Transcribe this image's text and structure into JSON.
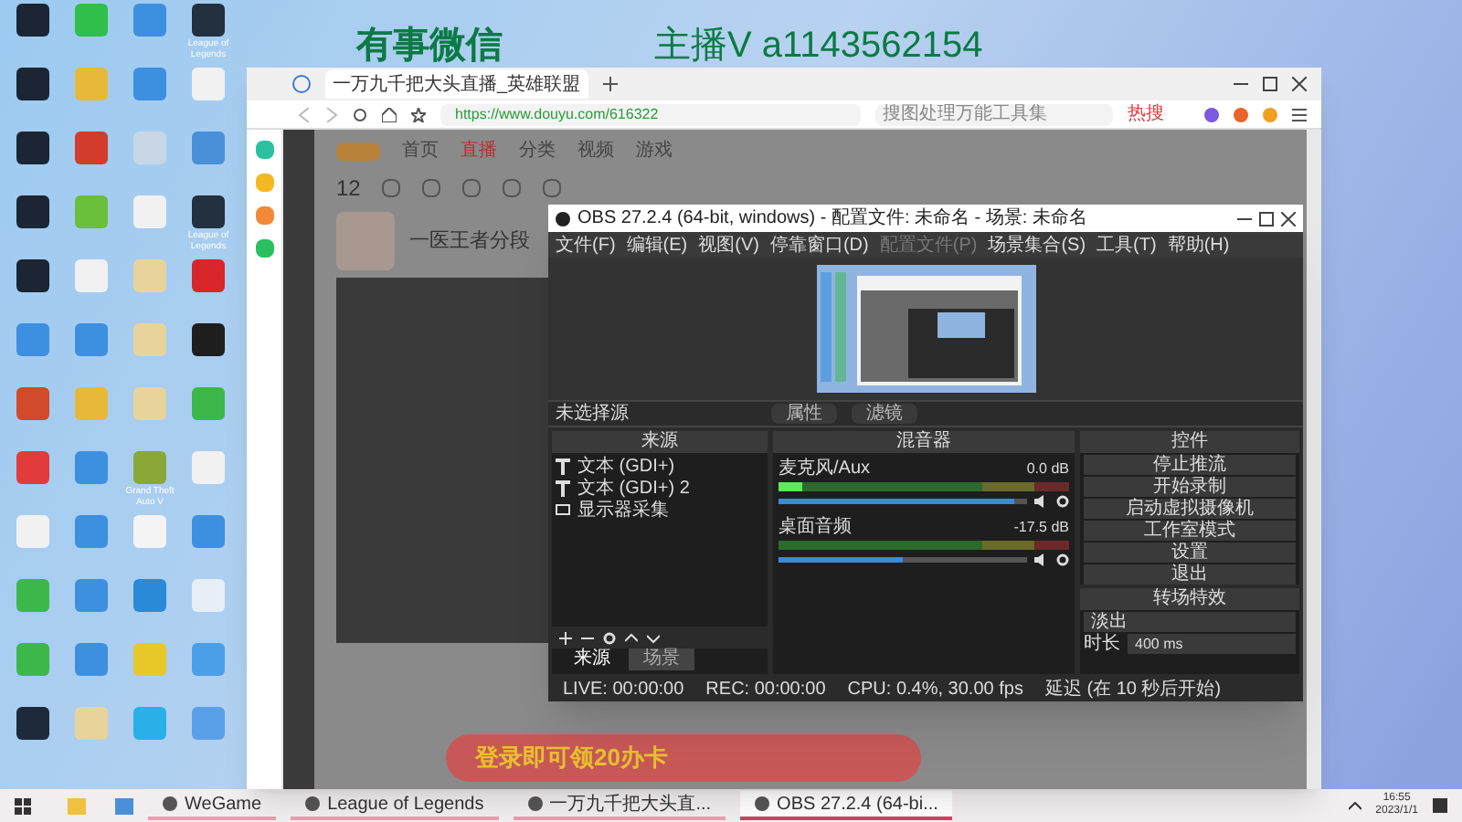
{
  "overlay_texts": [
    "有事微信",
    "主播V a1143562154"
  ],
  "desktop_icons": [
    {
      "color": "#1b2533"
    },
    {
      "color": "#2fbf4a"
    },
    {
      "color": "#3d8fe0"
    },
    {
      "color": "#22303f",
      "label": "League of Legends"
    },
    {
      "color": "#1b2533"
    },
    {
      "color": "#e8b838"
    },
    {
      "color": "#3d8fe0"
    },
    {
      "color": "#f1f1f1"
    },
    {
      "color": "#1b2533"
    },
    {
      "color": "#d23c2c"
    },
    {
      "color": "#c8d6e6"
    },
    {
      "color": "#4a90d9"
    },
    {
      "color": "#1b2533"
    },
    {
      "color": "#6bbf3a"
    },
    {
      "color": "#f1f1f1"
    },
    {
      "color": "#22303f",
      "label": "League of Legends"
    },
    {
      "color": "#1b2533"
    },
    {
      "color": "#f1f1f1"
    },
    {
      "color": "#e8d49a"
    },
    {
      "color": "#d8262a"
    },
    {
      "color": "#3d8fe0"
    },
    {
      "color": "#3d8fe0"
    },
    {
      "color": "#e8d49a"
    },
    {
      "color": "#1e1e1e"
    },
    {
      "color": "#d24a2a"
    },
    {
      "color": "#e8b838"
    },
    {
      "color": "#e8d49a"
    },
    {
      "color": "#3cb84a"
    },
    {
      "color": "#e23b3b"
    },
    {
      "color": "#3d8fe0"
    },
    {
      "color": "#8aa838",
      "label": "Grand Theft Auto V"
    },
    {
      "color": "#f1f1f1"
    },
    {
      "color": "#f1f1f1"
    },
    {
      "color": "#3d8fe0"
    },
    {
      "color": "#f4f4f4"
    },
    {
      "color": "#3d8fe0"
    },
    {
      "color": "#3cb84a"
    },
    {
      "color": "#3d8fe0"
    },
    {
      "color": "#2a8ad8"
    },
    {
      "color": "#e8eef6"
    },
    {
      "color": "#3cb84a"
    },
    {
      "color": "#3d8fe0"
    },
    {
      "color": "#e8c828"
    },
    {
      "color": "#4aa0e8"
    },
    {
      "color": "#1e2a3a"
    },
    {
      "color": "#e8d49a"
    },
    {
      "color": "#2ab0e8"
    },
    {
      "color": "#5aa0e8"
    }
  ],
  "browser": {
    "tab_title": "一万九千把大头直播_英雄联盟",
    "url": "https://www.douyu.com/616322",
    "search_placeholder": "搜图处理万能工具集",
    "hot_badge": "热搜",
    "page": {
      "nav": [
        {
          "label": "首页",
          "selected": false
        },
        {
          "label": "直播",
          "selected": true
        },
        {
          "label": "分类",
          "selected": false
        },
        {
          "label": "视频",
          "selected": false
        },
        {
          "label": "游戏",
          "selected": false
        }
      ],
      "follow_count": "12",
      "stream_title": "一医王者分段",
      "banner": "登录即可领20办卡"
    }
  },
  "obs": {
    "title": "OBS 27.2.4 (64-bit, windows) - 配置文件: 未命名 - 场景: 未命名",
    "menu": [
      {
        "label": "文件(F)",
        "disabled": false
      },
      {
        "label": "编辑(E)",
        "disabled": false
      },
      {
        "label": "视图(V)",
        "disabled": false
      },
      {
        "label": "停靠窗口(D)",
        "disabled": false
      },
      {
        "label": "配置文件(P)",
        "disabled": true
      },
      {
        "label": "场景集合(S)",
        "disabled": false
      },
      {
        "label": "工具(T)",
        "disabled": false
      },
      {
        "label": "帮助(H)",
        "disabled": false
      }
    ],
    "no_source": "未选择源",
    "source_buttons": [
      "属性",
      "滤镜"
    ],
    "sources_title": "来源",
    "sources": [
      {
        "name": "文本 (GDI+)",
        "kind": "text"
      },
      {
        "name": "文本 (GDI+) 2",
        "kind": "text"
      },
      {
        "name": "显示器采集",
        "kind": "display"
      }
    ],
    "bottom_tabs": [
      {
        "label": "来源",
        "selected": true
      },
      {
        "label": "场景",
        "selected": false
      }
    ],
    "mixer_title": "混音器",
    "channels": [
      {
        "name": "麦克风/Aux",
        "reading": "0.0 dB",
        "meter": {
          "level": 0.08
        },
        "volume": {
          "level": 0.95
        }
      },
      {
        "name": "桌面音频",
        "reading": "-17.5 dB",
        "meter": {
          "level": 0.0
        },
        "volume": {
          "level": 0.5
        }
      }
    ],
    "controls_title": "控件",
    "controls": [
      "停止推流",
      "开始录制",
      "启动虚拟摄像机",
      "工作室模式",
      "设置",
      "退出"
    ],
    "transition_title": "转场特效",
    "transition": "淡出",
    "duration_label": "时长",
    "duration": "400 ms",
    "status": [
      "LIVE: 00:00:00",
      "REC: 00:00:00",
      "CPU: 0.4%, 30.00 fps",
      "延迟 (在 10 秒后开始)"
    ]
  },
  "taskbar": {
    "items": [
      {
        "label": "WeGame",
        "active": false
      },
      {
        "label": "League of Legends",
        "active": false
      },
      {
        "label": "一万九千把大头直...",
        "active": false
      },
      {
        "label": "OBS 27.2.4 (64-bi...",
        "active": true
      }
    ],
    "time": "16:55",
    "date": "2023/1/1"
  }
}
